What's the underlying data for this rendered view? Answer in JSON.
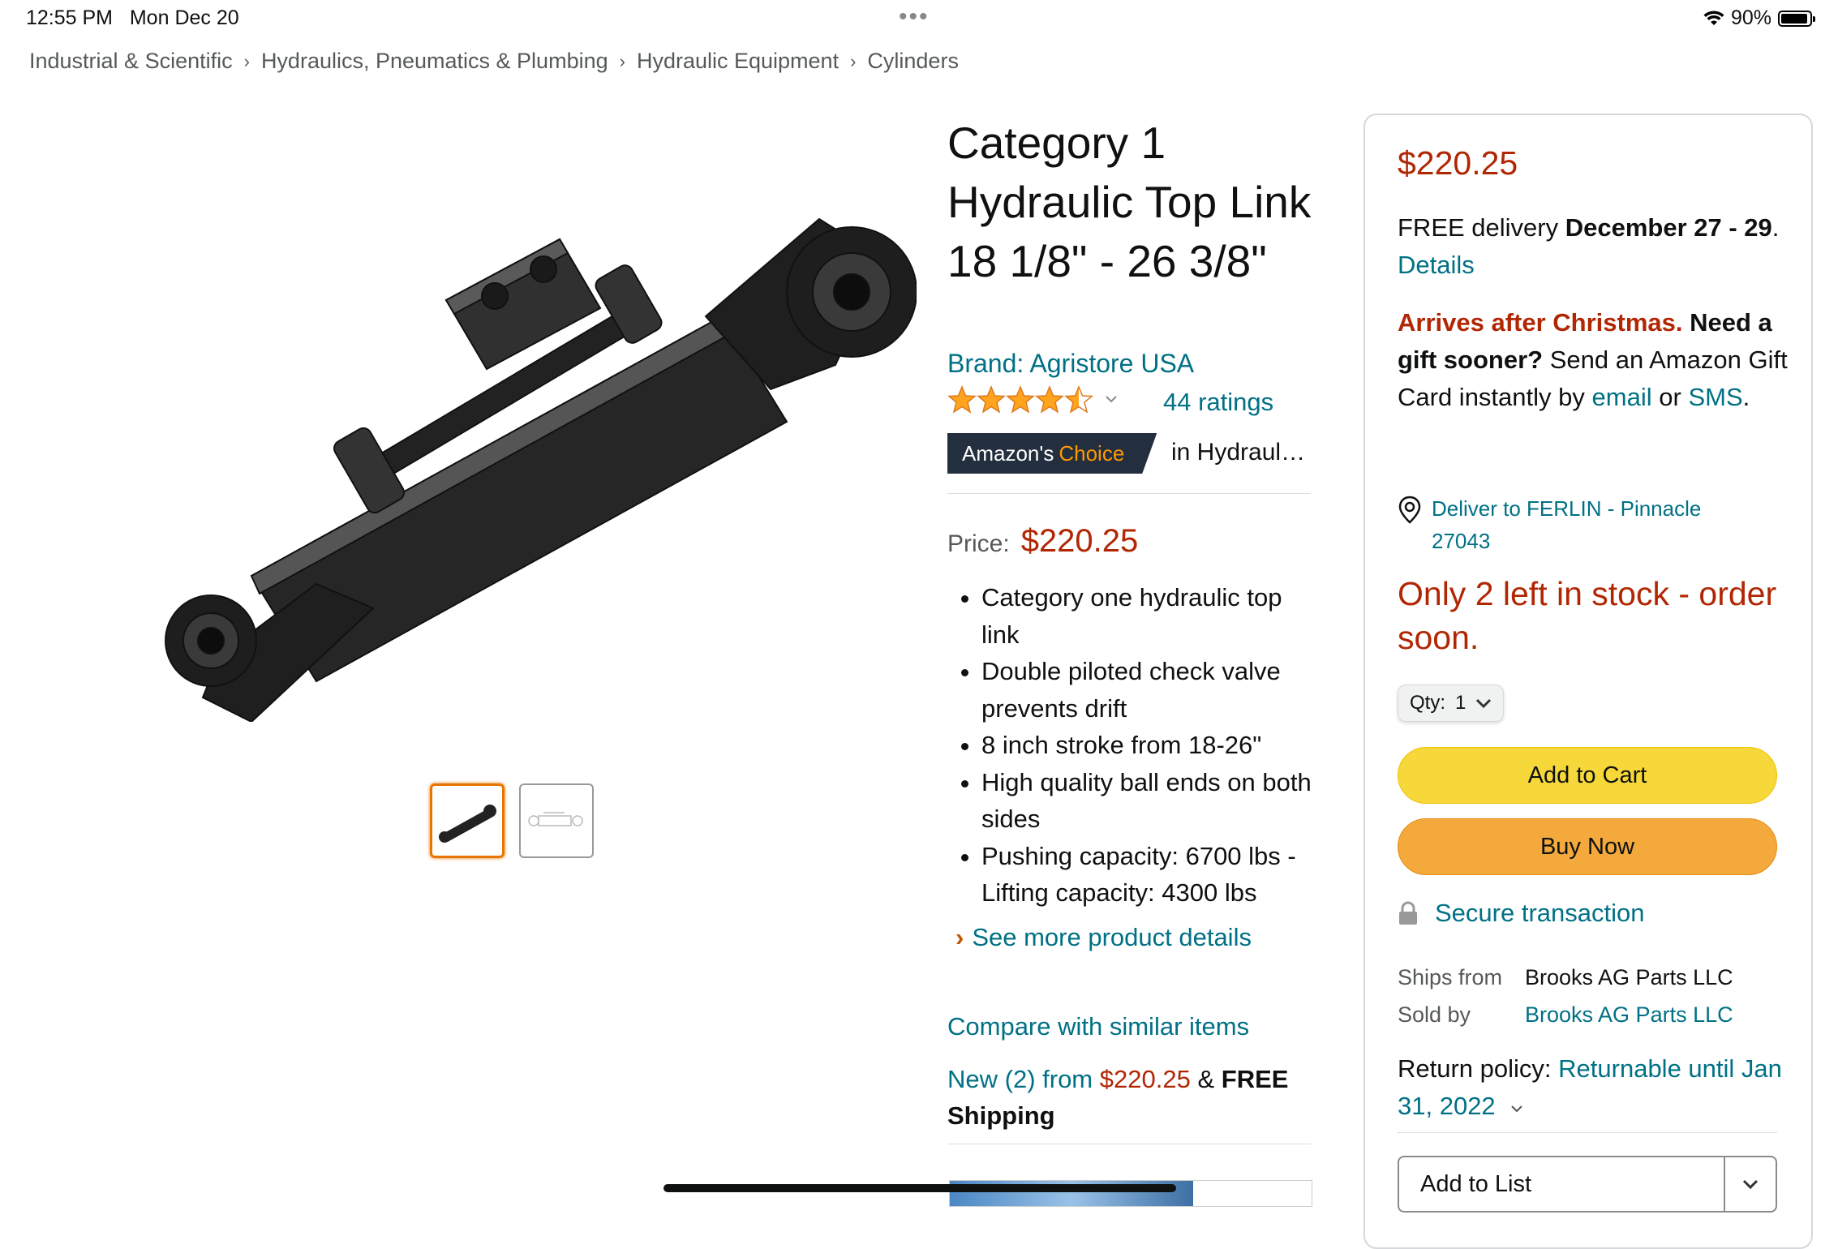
{
  "status_bar": {
    "time": "12:55 PM",
    "date": "Mon Dec 20",
    "dots": "•••",
    "battery": "90%",
    "battery_level": 0.9
  },
  "breadcrumb": [
    "Industrial & Scientific",
    "Hydraulics, Pneumatics & Plumbing",
    "Hydraulic Equipment",
    "Cylinders"
  ],
  "breadcrumb_sep": "›",
  "product": {
    "title": "Category 1 Hydraulic Top Link 18 1/8\" - 26 3/8\"",
    "brand": "Brand: Agristore USA",
    "rating_stars": 4.5,
    "ratings_count": "44 ratings",
    "badge": {
      "prefix": "Amazon's",
      "highlight": "Choice",
      "category": "in Hydraulic Cylinders"
    },
    "price_label": "Price:",
    "price": "$220.25",
    "bullets": [
      "Category one hydraulic top link",
      "Double piloted check valve prevents drift",
      "8 inch stroke from 18-26\"",
      "High quality ball ends on both sides",
      "Pushing capacity: 6700 lbs - Lifting capacity: 4300 lbs"
    ],
    "see_more": "See more product details",
    "compare": "Compare with similar items",
    "new_from": {
      "prefix": "New (2) from",
      "price": "$220.25",
      "amp": "&",
      "shipping": "FREE Shipping"
    }
  },
  "buybox": {
    "price": "$220.25",
    "delivery": {
      "prefix": "FREE delivery",
      "dates": "December 27 - 29",
      "period": ".",
      "details": "Details"
    },
    "gift": {
      "alert": "Arrives after Christmas.",
      "question": "Need a gift sooner?",
      "text": "Send an Amazon Gift Card instantly by",
      "email": "email",
      "or": "or",
      "sms": "SMS",
      "period": "."
    },
    "deliver_to": "Deliver to FERLIN - Pinnacle 27043",
    "stock": "Only 2 left in stock - order soon.",
    "qty_label": "Qty:",
    "qty_value": "1",
    "add_to_cart": "Add to Cart",
    "buy_now": "Buy Now",
    "secure": "Secure transaction",
    "ships_from_label": "Ships from",
    "ships_from": "Brooks AG Parts LLC",
    "sold_by_label": "Sold by",
    "sold_by": "Brooks AG Parts LLC",
    "return_label": "Return policy:",
    "return_value": "Returnable until Jan 31, 2022",
    "add_to_list": "Add to List"
  },
  "colors": {
    "link": "#007185",
    "price": "#B12704",
    "cart": "#F7D83B",
    "buy": "#F3A93B",
    "badge_bg": "#232F3E",
    "badge_accent": "#FF9900"
  }
}
